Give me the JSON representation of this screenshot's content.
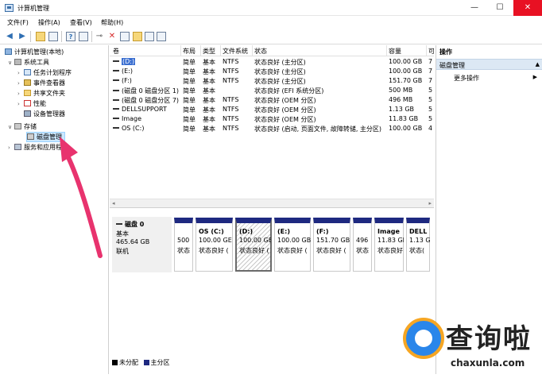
{
  "window": {
    "title": "计算机管理",
    "close": "✕",
    "minimize": "—",
    "maximize": "☐"
  },
  "menu": [
    "文件(F)",
    "操作(A)",
    "查看(V)",
    "帮助(H)"
  ],
  "tree": {
    "root": "计算机管理(本地)",
    "system_tools": "系统工具",
    "task_scheduler": "任务计划程序",
    "event_viewer": "事件查看器",
    "shared_folders": "共享文件夹",
    "performance": "性能",
    "device_manager": "设备管理器",
    "storage": "存储",
    "disk_management": "磁盘管理",
    "services_apps": "服务和应用程序"
  },
  "volumes": {
    "headers": [
      "卷",
      "布局",
      "类型",
      "文件系统",
      "状态",
      "容量",
      "可"
    ],
    "rows": [
      {
        "name": "(D:)",
        "layout": "简单",
        "type": "基本",
        "fs": "NTFS",
        "status": "状态良好 (主分区)",
        "capacity": "100.00 GB",
        "free": "7"
      },
      {
        "name": "(E:)",
        "layout": "简单",
        "type": "基本",
        "fs": "NTFS",
        "status": "状态良好 (主分区)",
        "capacity": "100.00 GB",
        "free": "7"
      },
      {
        "name": "(F:)",
        "layout": "简单",
        "type": "基本",
        "fs": "NTFS",
        "status": "状态良好 (主分区)",
        "capacity": "151.70 GB",
        "free": "7"
      },
      {
        "name": "(磁盘 0 磁盘分区 1)",
        "layout": "简单",
        "type": "基本",
        "fs": "",
        "status": "状态良好 (EFI 系统分区)",
        "capacity": "500 MB",
        "free": "5"
      },
      {
        "name": "(磁盘 0 磁盘分区 7)",
        "layout": "简单",
        "type": "基本",
        "fs": "NTFS",
        "status": "状态良好 (OEM 分区)",
        "capacity": "496 MB",
        "free": "5"
      },
      {
        "name": "DELLSUPPORT",
        "layout": "简单",
        "type": "基本",
        "fs": "NTFS",
        "status": "状态良好 (OEM 分区)",
        "capacity": "1.13 GB",
        "free": "5"
      },
      {
        "name": "Image",
        "layout": "简单",
        "type": "基本",
        "fs": "NTFS",
        "status": "状态良好 (OEM 分区)",
        "capacity": "11.83 GB",
        "free": "5"
      },
      {
        "name": "OS (C:)",
        "layout": "简单",
        "type": "基本",
        "fs": "NTFS",
        "status": "状态良好 (启动, 页面文件, 故障转储, 主分区)",
        "capacity": "100.00 GB",
        "free": "4"
      }
    ]
  },
  "disk": {
    "name": "磁盘 0",
    "type": "基本",
    "size": "465.64 GB",
    "state": "联机",
    "partitions": [
      {
        "name": "",
        "size": "500",
        "status": "状态"
      },
      {
        "name": "OS (C:)",
        "size": "100.00 GE",
        "status": "状态良好 ("
      },
      {
        "name": "(D:)",
        "size": "100.00 GE",
        "status": "状态良好 ("
      },
      {
        "name": "(E:)",
        "size": "100.00 GB",
        "status": "状态良好 ("
      },
      {
        "name": "(F:)",
        "size": "151.70 GB",
        "status": "状态良好 ("
      },
      {
        "name": "",
        "size": "496",
        "status": "状态"
      },
      {
        "name": "Image",
        "size": "11.83 GB",
        "status": "状态良好"
      },
      {
        "name": "DELL",
        "size": "1.13 G",
        "status": "状态("
      }
    ]
  },
  "legend": {
    "unallocated": "未分配",
    "primary": "主分区"
  },
  "actions": {
    "title": "操作",
    "section": "磁盘管理",
    "more": "更多操作"
  },
  "watermark": {
    "cn": "查询啦",
    "en": "chaxunla.com"
  },
  "colors": {
    "partition_bar": "#1e2980",
    "unallocated": "#000000",
    "primary": "#1e2980",
    "arrow": "#e8336e"
  }
}
